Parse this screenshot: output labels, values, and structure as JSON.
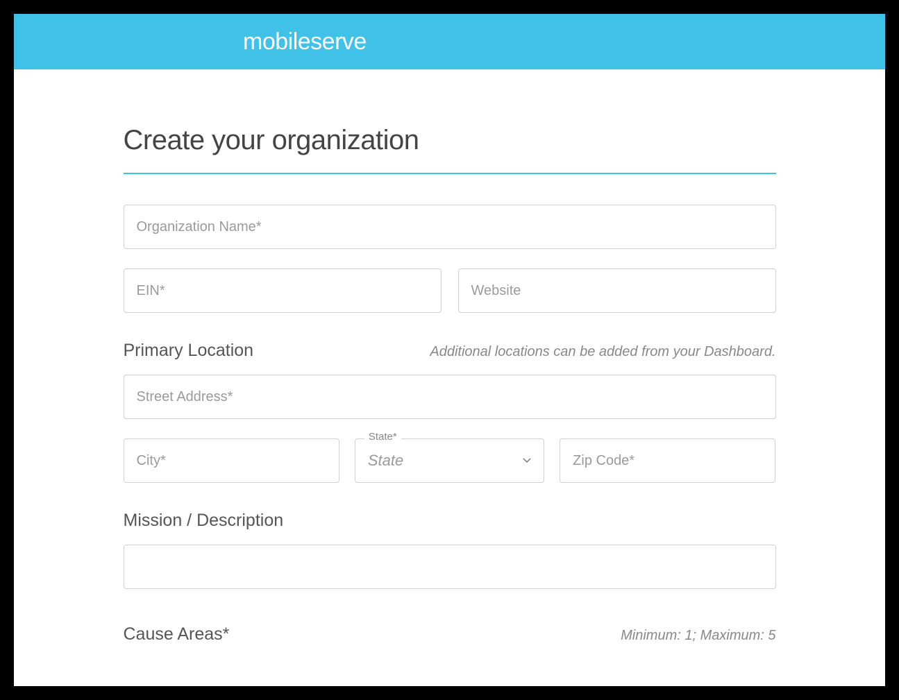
{
  "brand": {
    "logo": "mobileserve"
  },
  "title": "Create your organization",
  "fields": {
    "org_name_placeholder": "Organization Name*",
    "ein_placeholder": "EIN*",
    "website_placeholder": "Website",
    "street_placeholder": "Street Address*",
    "city_placeholder": "City*",
    "zip_placeholder": "Zip Code*"
  },
  "sections": {
    "location_label": "Primary Location",
    "location_hint": "Additional locations can be added from your Dashboard.",
    "mission_label": "Mission / Description",
    "cause_label": "Cause Areas*",
    "cause_hint": "Minimum: 1; Maximum: 5"
  },
  "state_select": {
    "legend": "State*",
    "value": "State"
  }
}
